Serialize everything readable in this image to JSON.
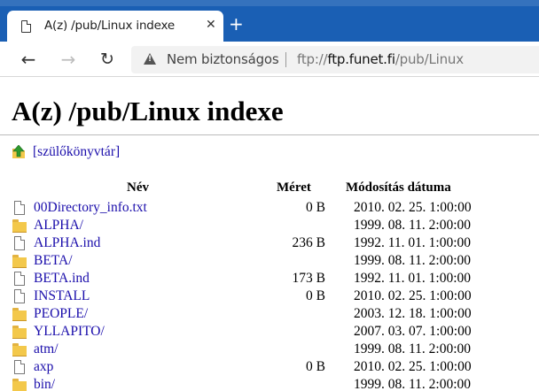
{
  "browser": {
    "tab": {
      "title": "A(z) /pub/Linux indexe",
      "close_glyph": "✕",
      "page_icon": "page-icon"
    },
    "new_tab_glyph": "+",
    "nav": {
      "back_glyph": "←",
      "forward_glyph": "→",
      "reload_glyph": "↻"
    },
    "address": {
      "security_label": "Nem biztonságos",
      "url_scheme": "ftp://",
      "url_host": "ftp.funet.fi",
      "url_path": "/pub/Linux"
    },
    "colors": {
      "titlebar": "#1a5fb4",
      "link": "#1a0dab"
    }
  },
  "page": {
    "title": "A(z) /pub/Linux indexe",
    "parent_link": "[szülőkönyvtár]",
    "columns": {
      "name": "Név",
      "size": "Méret",
      "date": "Módosítás dátuma"
    },
    "rows": [
      {
        "icon": "file-icon",
        "name": "00Directory_info.txt",
        "size": "0 B",
        "date": "2010. 02. 25. 1:00:00"
      },
      {
        "icon": "folder-icon",
        "name": "ALPHA/",
        "size": "",
        "date": "1999. 08. 11. 2:00:00"
      },
      {
        "icon": "file-icon",
        "name": "ALPHA.ind",
        "size": "236 B",
        "date": "1992. 11. 01. 1:00:00"
      },
      {
        "icon": "folder-icon",
        "name": "BETA/",
        "size": "",
        "date": "1999. 08. 11. 2:00:00"
      },
      {
        "icon": "file-icon",
        "name": "BETA.ind",
        "size": "173 B",
        "date": "1992. 11. 01. 1:00:00"
      },
      {
        "icon": "file-icon",
        "name": "INSTALL",
        "size": "0 B",
        "date": "2010. 02. 25. 1:00:00"
      },
      {
        "icon": "folder-icon",
        "name": "PEOPLE/",
        "size": "",
        "date": "2003. 12. 18. 1:00:00"
      },
      {
        "icon": "folder-icon",
        "name": "YLLAPITO/",
        "size": "",
        "date": "2007. 03. 07. 1:00:00"
      },
      {
        "icon": "folder-icon",
        "name": "atm/",
        "size": "",
        "date": "1999. 08. 11. 2:00:00"
      },
      {
        "icon": "file-icon",
        "name": "axp",
        "size": "0 B",
        "date": "2010. 02. 25. 1:00:00"
      },
      {
        "icon": "folder-icon",
        "name": "bin/",
        "size": "",
        "date": "1999. 08. 11. 2:00:00"
      }
    ]
  }
}
